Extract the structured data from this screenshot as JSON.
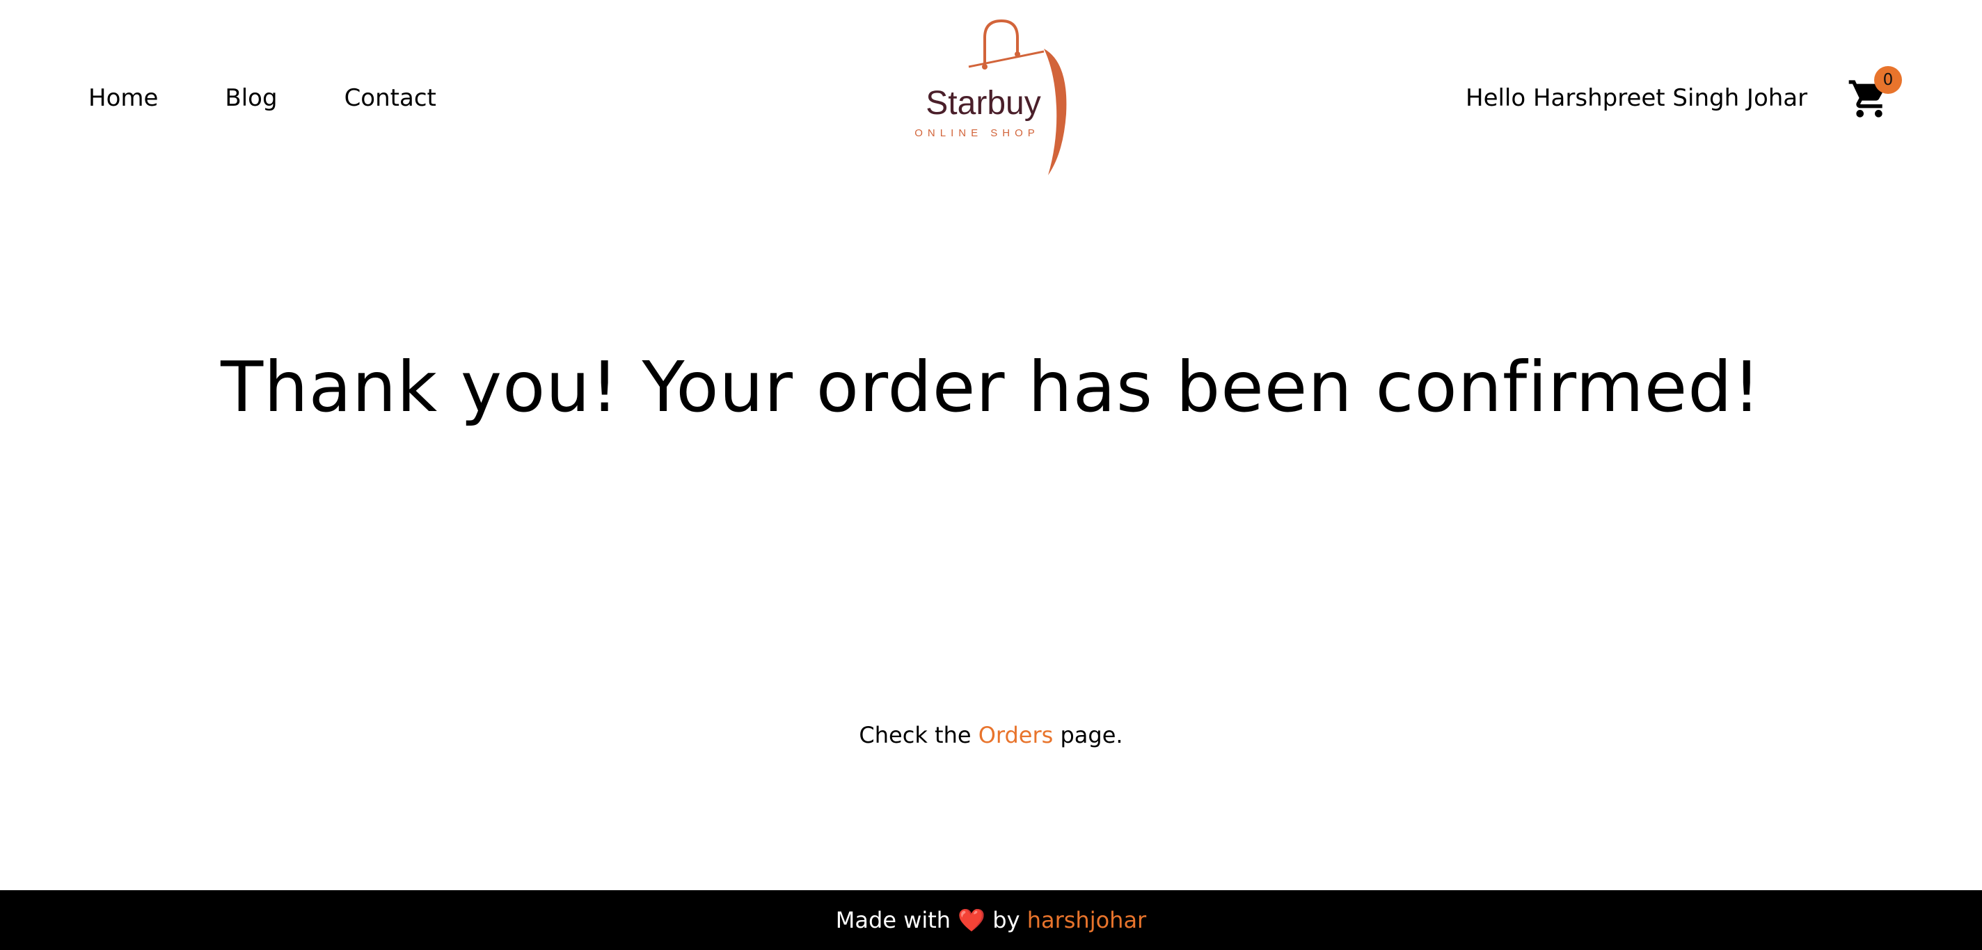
{
  "header": {
    "nav": [
      {
        "label": "Home"
      },
      {
        "label": "Blog"
      },
      {
        "label": "Contact"
      }
    ],
    "logo": {
      "name": "Starbuy",
      "tagline": "ONLINE SHOP",
      "brand_dark": "#4a1f2a",
      "brand_accent": "#d2643a"
    },
    "greeting": "Hello Harshpreet Singh Johar",
    "cart": {
      "count": "0",
      "icon": "shopping-cart-icon",
      "badge_color": "#e8742c"
    }
  },
  "main": {
    "headline": "Thank you! Your order has been confirmed!",
    "orders_prefix": "Check the",
    "orders_link": "Orders",
    "orders_suffix": "page."
  },
  "footer": {
    "prefix": "Made with",
    "heart": "❤️",
    "by": "by",
    "author": "harshjohar",
    "accent": "#e8742c"
  }
}
